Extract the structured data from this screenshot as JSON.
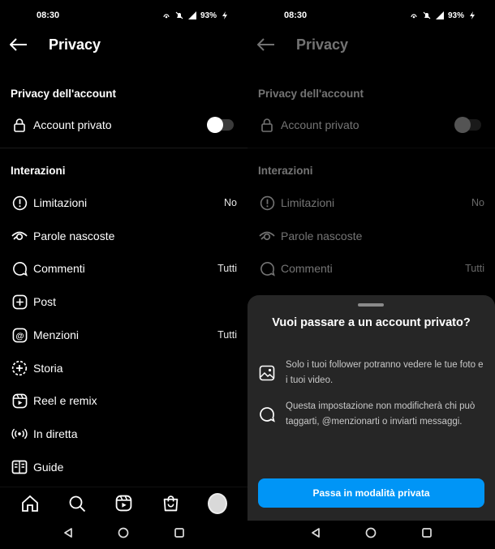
{
  "status": {
    "time": "08:30",
    "battery": "93%"
  },
  "page": {
    "title": "Privacy"
  },
  "account_section": {
    "title": "Privacy dell'account",
    "private_label": "Account privato"
  },
  "interactions_section": {
    "title": "Interazioni",
    "items": [
      {
        "label": "Limitazioni",
        "value": "No",
        "icon": "alert-circle-icon"
      },
      {
        "label": "Parole nascoste",
        "value": "",
        "icon": "eye-off-icon"
      },
      {
        "label": "Commenti",
        "value": "Tutti",
        "icon": "comment-icon"
      },
      {
        "label": "Post",
        "value": "",
        "icon": "plus-square-icon"
      },
      {
        "label": "Menzioni",
        "value": "Tutti",
        "icon": "at-icon"
      },
      {
        "label": "Storia",
        "value": "",
        "icon": "story-plus-icon"
      },
      {
        "label": "Reel e remix",
        "value": "",
        "icon": "reels-icon"
      },
      {
        "label": "In diretta",
        "value": "",
        "icon": "live-icon"
      },
      {
        "label": "Guide",
        "value": "",
        "icon": "guide-icon"
      }
    ]
  },
  "tabbar": [
    "home-icon",
    "search-icon",
    "reels-icon",
    "shop-icon",
    "profile-avatar"
  ],
  "navbar": [
    "back-triangle-icon",
    "home-circle-icon",
    "recents-square-icon"
  ],
  "sheet": {
    "title": "Vuoi passare a un account privato?",
    "item1": "Solo i tuoi follower potranno vedere le tue foto e i tuoi video.",
    "item2": "Questa impostazione non modificherà chi può taggarti, @menzionarti o inviarti messaggi.",
    "button": "Passa in modalità privata"
  },
  "colors": {
    "primary_button": "#0095f6",
    "sheet_bg": "#262626"
  }
}
